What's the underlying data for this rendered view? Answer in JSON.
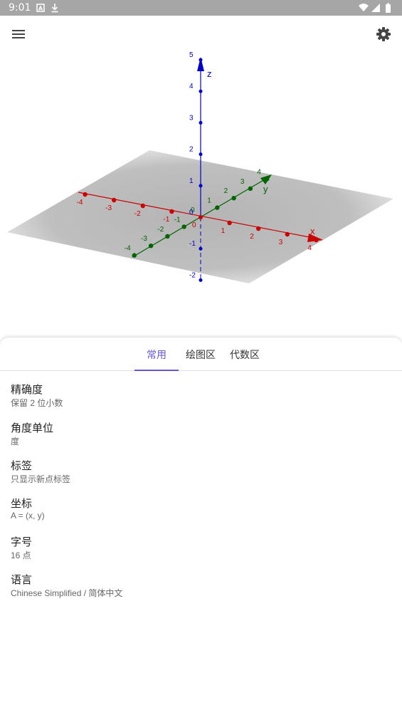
{
  "status_bar": {
    "time": "9:01",
    "left_icons": [
      "a-notification-icon",
      "download-icon"
    ],
    "right_icons": [
      "wifi-icon",
      "cell-signal-icon",
      "battery-icon"
    ]
  },
  "toolbar": {
    "menu_icon": "menu-icon",
    "settings_icon": "gear-icon"
  },
  "graph3d": {
    "axes": {
      "x": {
        "label": "x",
        "color": "#cc0000",
        "ticks": [
          "-4",
          "-3",
          "-2",
          "-1",
          "0",
          "1",
          "2",
          "3",
          "4"
        ]
      },
      "y": {
        "label": "y",
        "color": "#006400",
        "ticks": [
          "-4",
          "-3",
          "-2",
          "-1",
          "0",
          "1",
          "2",
          "3",
          "4"
        ]
      },
      "z": {
        "label": "z",
        "color": "#0000cc",
        "ticks": [
          "-2",
          "-1",
          "0",
          "1",
          "2",
          "3",
          "4",
          "5"
        ]
      }
    },
    "plane_color": "#bdbdbd"
  },
  "tabs": [
    {
      "label": "常用",
      "active": true
    },
    {
      "label": "绘图区",
      "active": false
    },
    {
      "label": "代数区",
      "active": false
    }
  ],
  "accent_color": "#6557d2",
  "settings": [
    {
      "title": "精确度",
      "value": "保留 2 位小数"
    },
    {
      "title": "角度单位",
      "value": "度"
    },
    {
      "title": "标签",
      "value": "只显示新点标签"
    },
    {
      "title": "坐标",
      "value": "A = (x, y)"
    },
    {
      "title": "字号",
      "value": "16 点"
    },
    {
      "title": "语言",
      "value": "Chinese Simplified / 简体中文"
    }
  ]
}
